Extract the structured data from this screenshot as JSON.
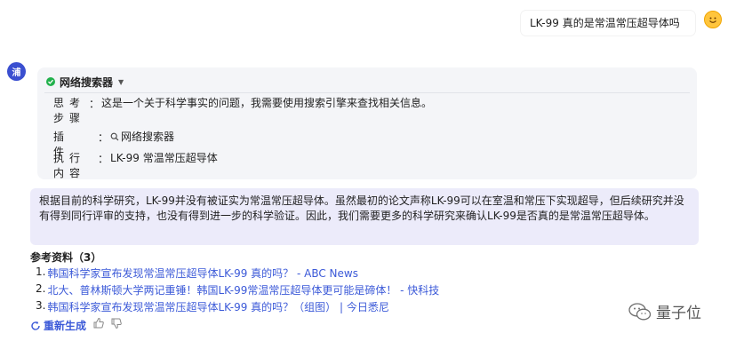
{
  "user_message": "LK-99 真的是常温常压超导体吗",
  "bot_avatar_text": "浦",
  "plugin": {
    "title": "网络搜索器",
    "rows": [
      {
        "key": "思考步骤",
        "value": "这是一个关于科学事实的问题，我需要使用搜索引擎来查找相关信息。"
      },
      {
        "key": "插件",
        "value": "网络搜索器"
      },
      {
        "key": "执行内容",
        "value": "LK-99 常温常压超导体"
      }
    ]
  },
  "answer": "根据目前的科学研究，LK-99并没有被证实为常温常压超导体。虽然最初的论文声称LK-99可以在室温和常压下实现超导，但后续研究并没有得到同行评审的支持，也没有得到进一步的科学验证。因此，我们需要更多的科学研究来确认LK-99是否真的是常温常压超导体。",
  "references": {
    "title": "参考资料（3）",
    "items": [
      {
        "num": "1.",
        "text": "韩国科学家宣布发现常温常压超导体LK-99 真的吗？ - ABC News"
      },
      {
        "num": "2.",
        "text": "北大、普林斯顿大学两记重锤！韩国LK-99常温常压超导体更可能是碲体！ - 快科技"
      },
      {
        "num": "3.",
        "text": "韩国科学家宣布发现常温常压超导体LK-99 真的吗？（组图） | 今日悉尼"
      }
    ]
  },
  "actions": {
    "regenerate": "重新生成"
  },
  "watermark": "量子位",
  "colors": {
    "accent": "#3c5ad8",
    "answer_bg": "#ecebfa",
    "plugin_bg": "#f4f5f8",
    "bot_avatar": "#3a4fd0",
    "success": "#22b14c"
  }
}
